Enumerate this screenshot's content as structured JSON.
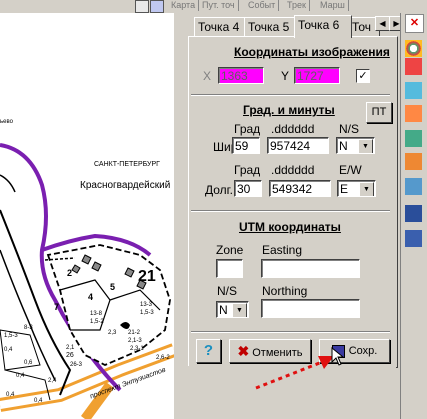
{
  "toolbar": {
    "items": [
      "Карта",
      "Пут. точ",
      "Событ",
      "Трек",
      "Марш"
    ]
  },
  "tabs": {
    "items": [
      "Точка 4",
      "Точка 5",
      "Точка 6",
      "Точ"
    ],
    "active": "Точка 6"
  },
  "image_coords": {
    "title": "Координаты изображения",
    "x_label": "X",
    "x_value": "1363",
    "y_label": "Y",
    "y_value": "1727",
    "checkbox_mark": "✓",
    "field_color": "#ff00ff"
  },
  "degmin": {
    "title": "Град. и минуты",
    "pt_button": "ПТ",
    "lat": {
      "label": "Шир",
      "deg_header": "Град",
      "min_header": ".dddddd",
      "hemi_header": "N/S",
      "deg": "59",
      "min": "957424",
      "hemi": "N"
    },
    "lon": {
      "label": "Долг.",
      "deg_header": "Град",
      "min_header": ".dddddd",
      "hemi_header": "E/W",
      "deg": "30",
      "min": "549342",
      "hemi": "E"
    }
  },
  "utm": {
    "title": "UTM координаты",
    "zone_label": "Zone",
    "zone_value": "",
    "easting_label": "Easting",
    "easting_value": "",
    "ns_label": "N/S",
    "ns_value": "N",
    "northing_label": "Northing",
    "northing_value": ""
  },
  "buttons": {
    "help": "?",
    "cancel": "Отменить",
    "save": "Сохр."
  },
  "map": {
    "labels": {
      "city": "САНКТ-ПЕТЕРБУРГ",
      "district": "Красногвардейский",
      "frag": "ьево",
      "num21": "21",
      "road": "проспект Энтузиастов"
    },
    "plot_labels": [
      "2",
      "4",
      "13-8",
      "1,5-2",
      "13-3",
      "1,5-3",
      "21-2",
      "2,1-3",
      "2,3-1",
      "2,1",
      "26",
      "0,4",
      "0,4",
      "0,4",
      "0,6",
      "0,4",
      "8-3",
      "1,5-3",
      "2,6-2",
      "5",
      "7",
      "2,3",
      "26-3",
      "2,4"
    ]
  }
}
